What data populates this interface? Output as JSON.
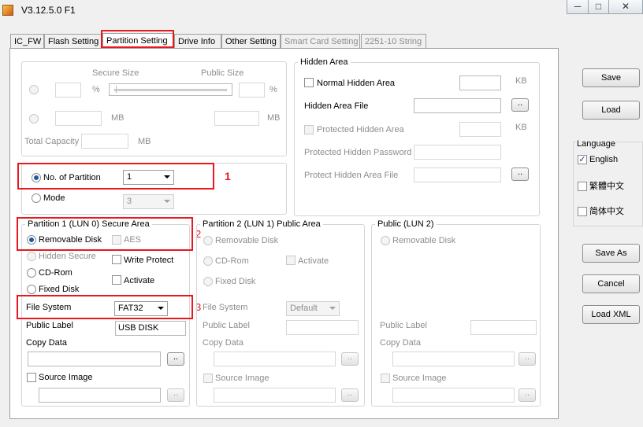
{
  "window": {
    "title": "V3.12.5.0 F1",
    "minimize": "─",
    "maximize": "□",
    "close": "✕"
  },
  "tabs": [
    {
      "label": "IC_FW"
    },
    {
      "label": "Flash Setting"
    },
    {
      "label": "Partition Setting"
    },
    {
      "label": "Drive Info"
    },
    {
      "label": "Other Setting"
    },
    {
      "label": "Smart Card Setting"
    },
    {
      "label": "2251-10 String"
    }
  ],
  "capacity": {
    "secure_size_label": "Secure Size",
    "public_size_label": "Public Size",
    "percent": "%",
    "mb": "MB",
    "total_capacity_label": "Total Capacity"
  },
  "partition": {
    "no_of_partition_label": "No. of Partition",
    "no_of_partition_value": "1",
    "mode_label": "Mode",
    "mode_value": "3"
  },
  "hidden_area": {
    "title": "Hidden Area",
    "normal_hidden_area": "Normal Hidden Area",
    "kb": "KB",
    "hidden_area_file": "Hidden Area File",
    "protected_hidden_area": "Protected Hidden Area",
    "protected_hidden_password": "Protected Hidden Password",
    "protected_hidden_area_file": "Protect Hidden Area File",
    "browse": ".."
  },
  "partition1": {
    "title": "Partition 1 (LUN 0) Secure Area",
    "removable_disk": "Removable Disk",
    "aes": "AES",
    "hidden_secure": "Hidden Secure",
    "write_protect": "Write Protect",
    "cd_rom": "CD-Rom",
    "activate": "Activate",
    "fixed_disk": "Fixed Disk",
    "file_system_label": "File System",
    "file_system_value": "FAT32",
    "public_label": "Public Label",
    "public_label_value": "USB DISK",
    "copy_data": "Copy Data",
    "source_image": "Source Image",
    "browse": ".."
  },
  "partition2": {
    "title": "Partition 2 (LUN 1) Public Area",
    "removable_disk": "Removable Disk",
    "cd_rom": "CD-Rom",
    "activate": "Activate",
    "fixed_disk": "Fixed Disk",
    "file_system_label": "File System",
    "file_system_value": "Default",
    "public_label": "Public Label",
    "copy_data": "Copy Data",
    "source_image": "Source Image",
    "browse": ".."
  },
  "public_lun2": {
    "title": "Public (LUN 2)",
    "removable_disk": "Removable Disk",
    "public_label": "Public Label",
    "copy_data": "Copy Data",
    "source_image": "Source Image",
    "browse": ".."
  },
  "annotations": {
    "n1": "1",
    "n2": "2",
    "n3": "3"
  },
  "right_panel": {
    "save": "Save",
    "load": "Load",
    "language_title": "Language",
    "english": "English",
    "trad_chinese": "繁體中文",
    "simp_chinese": "简体中文",
    "save_as": "Save As",
    "cancel": "Cancel",
    "load_xml": "Load XML"
  },
  "colors": {
    "annotation_red": "#e8181e",
    "radio_dot": "#1b5a9e",
    "disabled_text": "#8d8d8d"
  }
}
